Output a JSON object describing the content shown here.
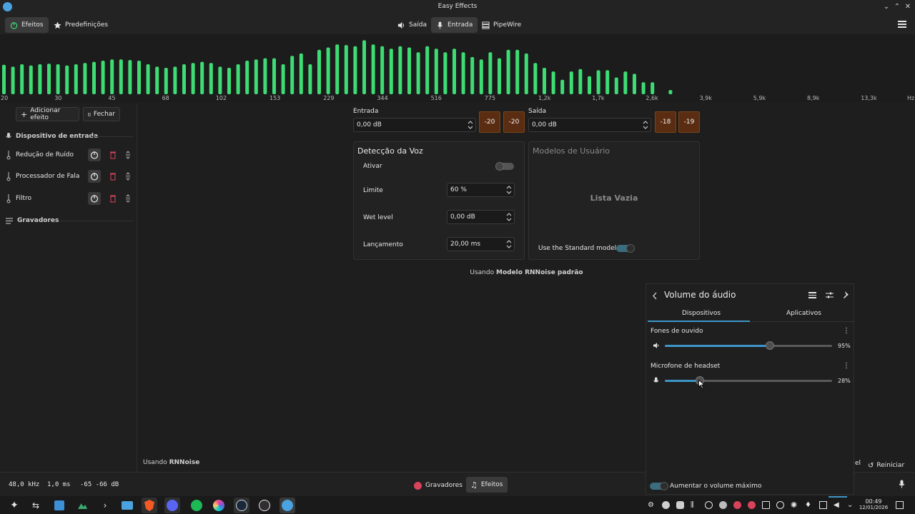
{
  "window": {
    "title": "Easy Effects",
    "controls": [
      "minimize",
      "maximize",
      "close"
    ]
  },
  "header": {
    "effects_label": "Efeitos",
    "presets_label": "Predefinições",
    "output_label": "Saída",
    "input_label": "Entrada",
    "pipewire_label": "PipeWire"
  },
  "spectrum": {
    "bar_color": "#3ddc74",
    "labels": [
      "20",
      "30",
      "45",
      "68",
      "102",
      "153",
      "229",
      "344",
      "516",
      "775",
      "1,2k",
      "1,7k",
      "2,6k",
      "3,9k",
      "5,9k",
      "8,9k",
      "13,3k",
      "Hz"
    ],
    "bar_levels": [
      0.49,
      0.46,
      0.5,
      0.48,
      0.5,
      0.51,
      0.5,
      0.48,
      0.5,
      0.52,
      0.54,
      0.56,
      0.58,
      0.58,
      0.57,
      0.56,
      0.5,
      0.46,
      0.44,
      0.46,
      0.5,
      0.52,
      0.54,
      0.52,
      0.46,
      0.44,
      0.5,
      0.56,
      0.58,
      0.6,
      0.6,
      0.5,
      0.64,
      0.68,
      0.5,
      0.74,
      0.78,
      0.83,
      0.82,
      0.8,
      0.9,
      0.83,
      0.8,
      0.76,
      0.8,
      0.78,
      0.7,
      0.8,
      0.76,
      0.7,
      0.76,
      0.7,
      0.62,
      0.58,
      0.7,
      0.6,
      0.74,
      0.74,
      0.68,
      0.52,
      0.44,
      0.38,
      0.24,
      0.38,
      0.42,
      0.3,
      0.4,
      0.4,
      0.28,
      0.38,
      0.34,
      0.2,
      0.2,
      0.0,
      0.07
    ]
  },
  "sidebar": {
    "add_effect_label": "Adicionar efeito",
    "close_label": "Fechar",
    "input_device_label": "Dispositivo de entrada",
    "effects": [
      {
        "label": "Redução de Ruído"
      },
      {
        "label": "Processador de Fala"
      },
      {
        "label": "Filtro"
      }
    ],
    "recorders_label": "Gravadores",
    "footer_prefix": "Usando",
    "footer_name": "RNNoise"
  },
  "levels": {
    "input_label": "Entrada",
    "input_value": "0,00 dB",
    "input_meters": [
      "-20",
      "-20"
    ],
    "output_label": "Saída",
    "output_value": "0,00 dB",
    "output_meters": [
      "-18",
      "-19"
    ]
  },
  "voice_detection": {
    "title": "Detecção da Voz",
    "enable_label": "Ativar",
    "limit_label": "Limite",
    "limit_value": "60 %",
    "wet_label": "Wet level",
    "wet_value": "0,00 dB",
    "release_label": "Lançamento",
    "release_value": "20,00 ms"
  },
  "user_models": {
    "title": "Modelos de Usuário",
    "empty_label": "Lista Vazia",
    "standard_model_label": "Use the Standard model"
  },
  "model_status": {
    "prefix": "Usando",
    "name": "Modelo RNNoise padrão"
  },
  "statusbar": {
    "sample_rate": "48,0 kHz",
    "latency": "1,0 ms",
    "level": "-65 -66 dB",
    "recorders_label": "Gravadores",
    "effects_label": "Efeitos",
    "reset_label": "Reiniciar",
    "partial_label": "el"
  },
  "volume_popup": {
    "title": "Volume do áudio",
    "tab_devices": "Dispositivos",
    "tab_apps": "Aplicativos",
    "devices": [
      {
        "name": "Fones de ouvido",
        "volume_text": "95%",
        "volume": 0.63
      },
      {
        "name": "Microfone de headset",
        "volume_text": "28%",
        "volume": 0.21
      }
    ],
    "boost_label": "Aumentar o volume máximo"
  },
  "taskbar": {
    "time": "00:49",
    "date": "12/01/2026"
  },
  "colors": {
    "accent": "#3d95c7",
    "meter_orange": "#5a2d12",
    "trash_red": "#d8435b",
    "record_red": "#d8435b"
  }
}
